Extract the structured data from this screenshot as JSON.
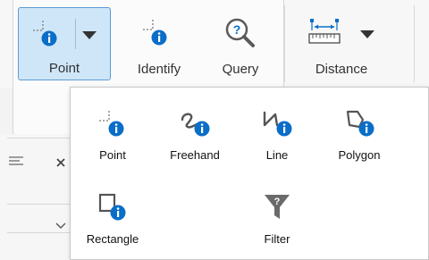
{
  "ribbon": {
    "point_label": "Point",
    "identify_label": "Identify",
    "query_label": "Query",
    "distance_label": "Distance"
  },
  "dropdown": {
    "tools": [
      {
        "label": "Point",
        "icon": "point-info-icon"
      },
      {
        "label": "Freehand",
        "icon": "freehand-info-icon"
      },
      {
        "label": "Line",
        "icon": "line-info-icon"
      },
      {
        "label": "Polygon",
        "icon": "polygon-info-icon"
      },
      {
        "label": "Rectangle",
        "icon": "rectangle-info-icon"
      },
      {
        "label": "Filter",
        "icon": "filter-icon"
      }
    ]
  },
  "colors": {
    "active_bg": "#cfe6f8",
    "active_border": "#5b9bd5",
    "info_blue": "#0a6ec8",
    "icon_gray": "#555555"
  }
}
